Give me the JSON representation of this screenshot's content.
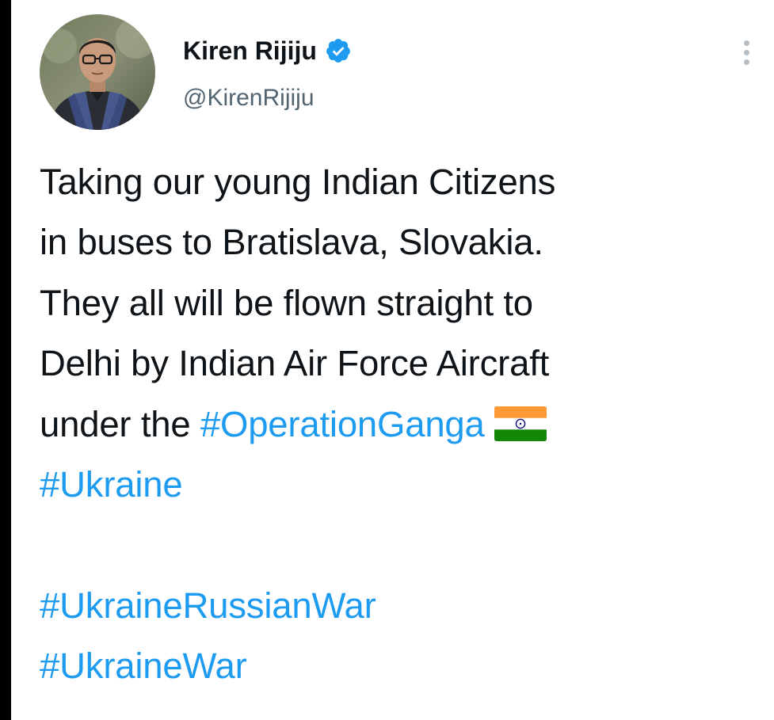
{
  "tweet": {
    "author": {
      "display_name": "Kiren Rijiju",
      "handle": "@KirenRijiju",
      "verified": true,
      "avatar_icon": "profile-photo"
    },
    "more_icon": "vertical-ellipsis-icon",
    "text_lines": [
      "Taking our young Indian Citizens",
      "in buses to Bratislava, Slovakia.",
      "They all will be flown straight to",
      "Delhi by Indian Air Force Aircraft",
      "under the "
    ],
    "hashtags": {
      "operation_ganga": "#OperationGanga",
      "ukraine": "#Ukraine",
      "ukraine_russian_war": "#UkraineRussianWar",
      "ukraine_war": "#UkraineWar"
    },
    "flag_emoji": "india-flag-icon"
  },
  "colors": {
    "text": "#0f1419",
    "handle": "#536471",
    "hashtag": "#1d9bf0",
    "verified": "#1d9bf0",
    "background": "#ffffff"
  }
}
